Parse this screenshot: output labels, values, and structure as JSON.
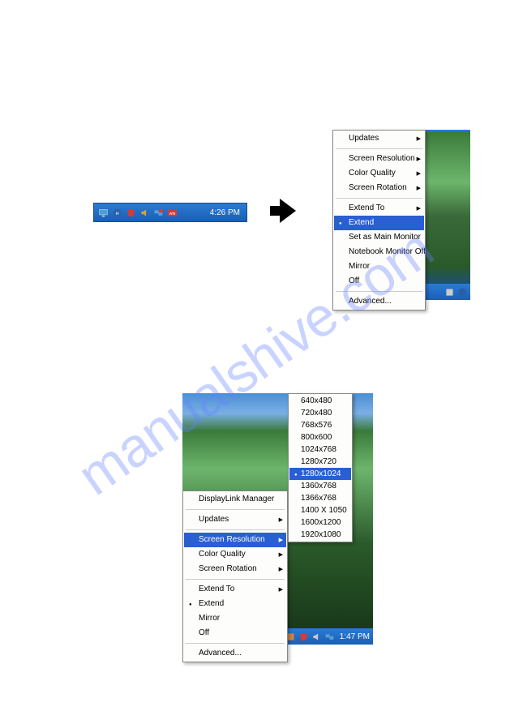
{
  "watermark": "manualshive.com",
  "taskbar": {
    "time": "4:26 PM",
    "icons": [
      "monitor",
      "hib",
      "shield-red",
      "audio",
      "network-x",
      "ati"
    ]
  },
  "menu1": {
    "items": [
      {
        "label": "Updates",
        "arrow": true
      },
      {
        "sep": true
      },
      {
        "label": "Screen Resolution",
        "arrow": true
      },
      {
        "label": "Color Quality",
        "arrow": true
      },
      {
        "label": "Screen Rotation",
        "arrow": true
      },
      {
        "sep": true
      },
      {
        "label": "Extend To",
        "arrow": true
      },
      {
        "label": "Extend",
        "selected": true,
        "bullet": true
      },
      {
        "label": "Set as Main Monitor"
      },
      {
        "label": "Notebook Monitor Off"
      },
      {
        "label": "Mirror"
      },
      {
        "label": "Off"
      },
      {
        "sep": true
      },
      {
        "label": "Advanced..."
      }
    ]
  },
  "menu2": {
    "items": [
      {
        "label": "DisplayLink Manager"
      },
      {
        "sep": true
      },
      {
        "label": "Updates",
        "arrow": true
      },
      {
        "sep": true
      },
      {
        "label": "Screen Resolution",
        "arrow": true,
        "selected": true
      },
      {
        "label": "Color Quality",
        "arrow": true
      },
      {
        "label": "Screen Rotation",
        "arrow": true
      },
      {
        "sep": true
      },
      {
        "label": "Extend To",
        "arrow": true
      },
      {
        "label": "Extend",
        "bullet": true
      },
      {
        "label": "Mirror"
      },
      {
        "label": "Off"
      },
      {
        "sep": true
      },
      {
        "label": "Advanced..."
      }
    ]
  },
  "resolutions": [
    {
      "label": "640x480"
    },
    {
      "label": "720x480"
    },
    {
      "label": "768x576"
    },
    {
      "label": "800x600"
    },
    {
      "label": "1024x768"
    },
    {
      "label": "1280x720"
    },
    {
      "label": "1280x1024",
      "selected": true,
      "bullet": true
    },
    {
      "label": "1360x768"
    },
    {
      "label": "1366x768"
    },
    {
      "label": "1400 X 1050"
    },
    {
      "label": "1600x1200"
    },
    {
      "label": "1920x1080"
    }
  ],
  "taskbar2": {
    "time": "1:47 PM",
    "icons": [
      "hib",
      "arrow",
      "shield",
      "audio",
      "network"
    ]
  }
}
